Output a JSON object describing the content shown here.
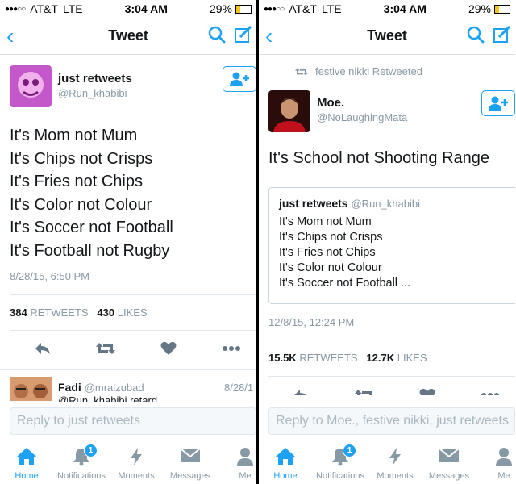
{
  "status_bar": {
    "carrier": "AT&T",
    "network": "LTE",
    "time": "3:04 AM",
    "battery": "29%",
    "battery_level": 0.29
  },
  "nav": {
    "title": "Tweet"
  },
  "left": {
    "author": {
      "name": "just retweets",
      "handle": "@Run_khabibi"
    },
    "text_lines": [
      "It's Mom not Mum",
      "It's Chips not Crisps",
      "It's Fries not Chips",
      "It's Color not Colour",
      "It's Soccer not Football",
      "It's Football not Rugby"
    ],
    "date": "8/28/15, 6:50 PM",
    "retweets": {
      "count": "384",
      "label": "RETWEETS"
    },
    "likes": {
      "count": "430",
      "label": "LIKES"
    },
    "reply_item": {
      "name": "Fadi",
      "handle": "@mralzubad",
      "date": "8/28/1",
      "preview": "@Run_khabibi retard"
    },
    "reply_placeholder": "Reply to just retweets"
  },
  "right": {
    "retweeted_by": "festive nikki Retweeted",
    "author": {
      "name": "Moe.",
      "handle": "@NoLaughingMata"
    },
    "text": "It's School not Shooting Range",
    "quote": {
      "name": "just retweets",
      "handle": "@Run_khabibi",
      "lines": [
        "It's Mom not Mum",
        "It's Chips not Crisps",
        "It's Fries not Chips",
        "It's Color not Colour",
        "It's Soccer not Football ..."
      ]
    },
    "date": "12/8/15, 12:24 PM",
    "retweets": {
      "count": "15.5K",
      "label": "RETWEETS"
    },
    "likes": {
      "count": "12.7K",
      "label": "LIKES"
    },
    "reply_placeholder": "Reply to Moe., festive nikki, just retweets"
  },
  "tabs": [
    {
      "label": "Home",
      "icon": "home-icon",
      "active": true
    },
    {
      "label": "Notifications",
      "icon": "bell-icon",
      "badge": "1"
    },
    {
      "label": "Moments",
      "icon": "lightning-icon"
    },
    {
      "label": "Messages",
      "icon": "envelope-icon"
    },
    {
      "label": "Me",
      "icon": "person-icon"
    }
  ],
  "colors": {
    "accent": "#1da1f2",
    "text": "#14171a",
    "muted": "#8899a6",
    "border": "#e1e8ed"
  }
}
